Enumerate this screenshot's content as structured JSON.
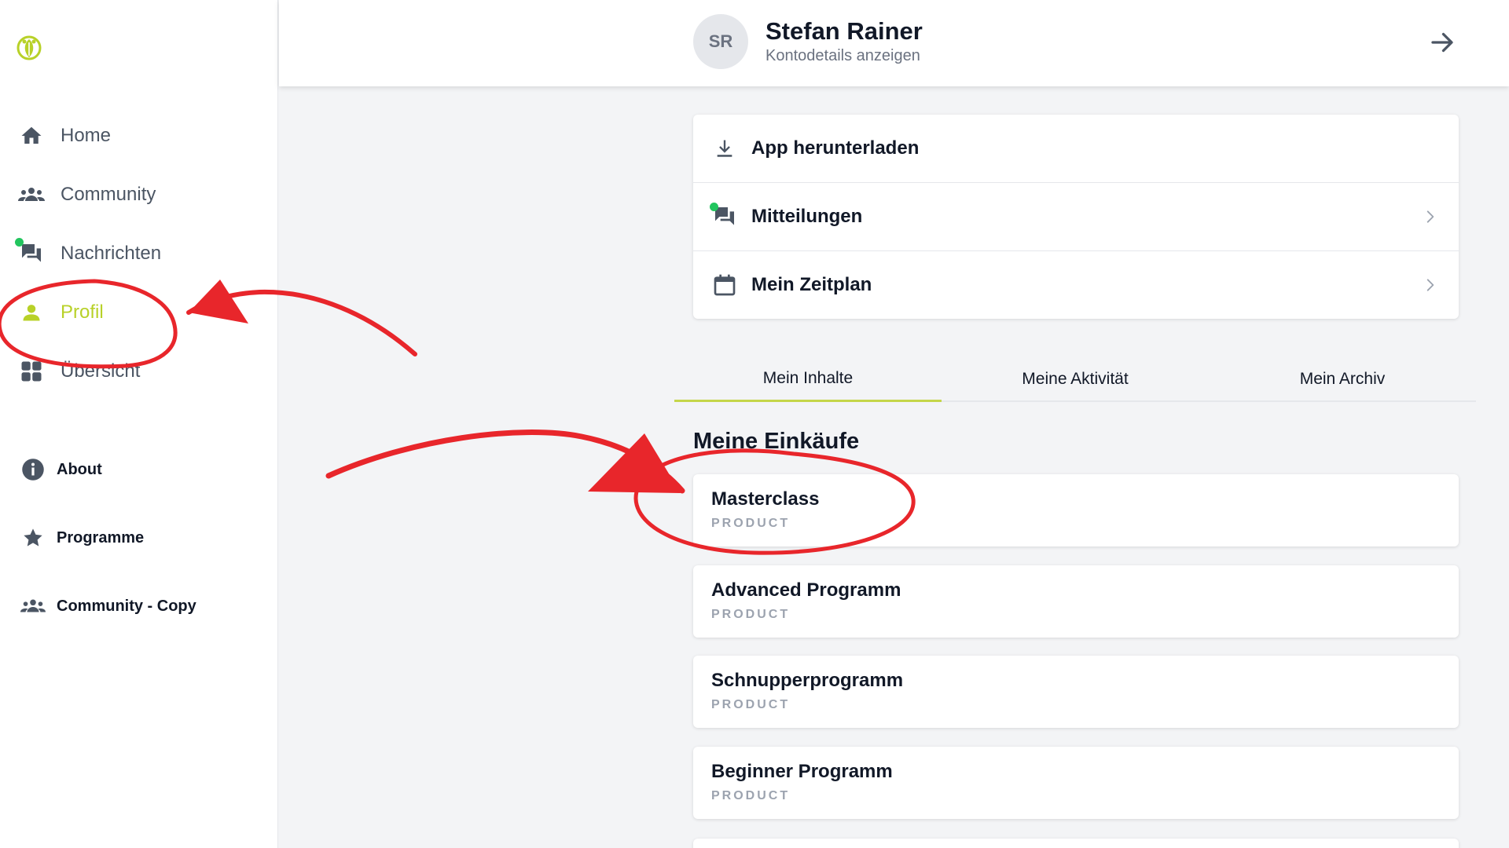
{
  "sidebar": {
    "logo_icon": "leaf-logo-icon",
    "nav_items": [
      {
        "label": "Home",
        "icon": "home-icon"
      },
      {
        "label": "Community",
        "icon": "people-icon"
      },
      {
        "label": "Nachrichten",
        "icon": "chat-icon",
        "has_dot": true
      },
      {
        "label": "Profil",
        "icon": "person-icon",
        "active": true
      },
      {
        "label": "Übersicht",
        "icon": "grid-icon"
      }
    ],
    "secondary_items": [
      {
        "label": "About",
        "icon": "info-icon"
      },
      {
        "label": "Programme",
        "icon": "star-icon"
      },
      {
        "label": "Community - Copy",
        "icon": "people-icon"
      }
    ]
  },
  "header": {
    "avatar_initials": "SR",
    "user_name": "Stefan Rainer",
    "user_subtitle": "Kontodetails anzeigen",
    "arrow_icon": "arrow-right-icon"
  },
  "menu": [
    {
      "label": "App herunterladen",
      "icon": "download-icon",
      "chevron": false
    },
    {
      "label": "Mitteilungen",
      "icon": "chat-icon",
      "chevron": true,
      "has_dot": true
    },
    {
      "label": "Mein Zeitplan",
      "icon": "calendar-icon",
      "chevron": true
    }
  ],
  "tabs": [
    {
      "label": "Mein Inhalte",
      "active": true
    },
    {
      "label": "Meine Aktivität",
      "active": false
    },
    {
      "label": "Mein Archiv",
      "active": false
    }
  ],
  "section_title": "Meine Einkäufe",
  "products": [
    {
      "name": "Masterclass",
      "tag": "PRODUCT"
    },
    {
      "name": "Advanced Programm",
      "tag": "PRODUCT"
    },
    {
      "name": "Schnupperprogramm",
      "tag": "PRODUCT"
    },
    {
      "name": "Beginner Programm",
      "tag": "PRODUCT"
    }
  ],
  "colors": {
    "accent": "#b8d128",
    "annotation_red": "#e8262b",
    "notification_dot": "#22c55e",
    "icon_gray": "#4b5563"
  }
}
